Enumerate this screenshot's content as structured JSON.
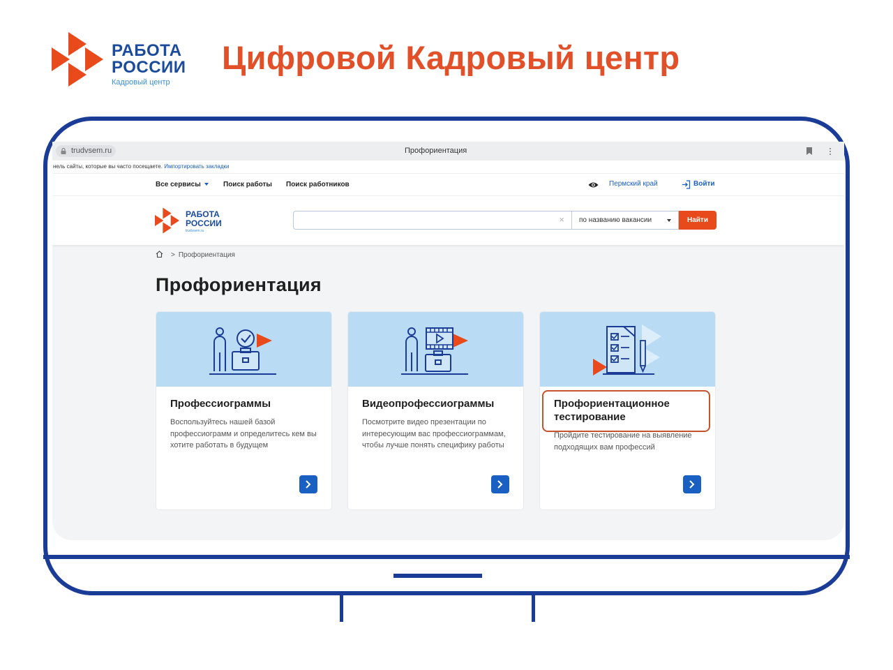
{
  "slide": {
    "logo_line1": "РАБОТА",
    "logo_line2": "РОССИИ",
    "logo_line3": "Кадровый центр",
    "title": "Цифровой Кадровый центр"
  },
  "browser": {
    "url": "trudvsem.ru",
    "tab_title": "Профориентация",
    "bookmarks_text": "нель сайты, которые вы часто посещаете.",
    "bookmarks_link": "Импортировать закладки"
  },
  "topnav": {
    "all_services": "Все сервисы",
    "job_search": "Поиск работы",
    "worker_search": "Поиск работников",
    "region": "Пермский край",
    "login": "Войти"
  },
  "header": {
    "logo_line1": "РАБОТА",
    "logo_line2": "РОССИИ",
    "logo_line3": "trudvsem.ru",
    "search_value": "",
    "search_clear": "×",
    "search_mode": "по названию вакансии",
    "search_button": "Найти"
  },
  "breadcrumb": {
    "sep": ">",
    "current": "Профориентация"
  },
  "page_title": "Профориентация",
  "cards": [
    {
      "title": "Профессиограммы",
      "description": "Воспользуйтесь нашей базой профессиограмм и определитесь кем вы хотите работать в будущем"
    },
    {
      "title": "Видеопрофессиограммы",
      "description": "Посмотрите видео презентации по интересующим вас профессиограммам, чтобы лучше понять специфику работы"
    },
    {
      "title": "Профориентационное тестирование",
      "description": "Пройдите тестирование на выявление подходящих вам профессий"
    }
  ],
  "colors": {
    "brand_blue": "#1a4b9c",
    "accent_orange": "#e2502a",
    "monitor_blue": "#1a3c96",
    "link_blue": "#1a5fc2",
    "banner_bg": "#b9dbf3"
  },
  "highlighted_card": 2
}
